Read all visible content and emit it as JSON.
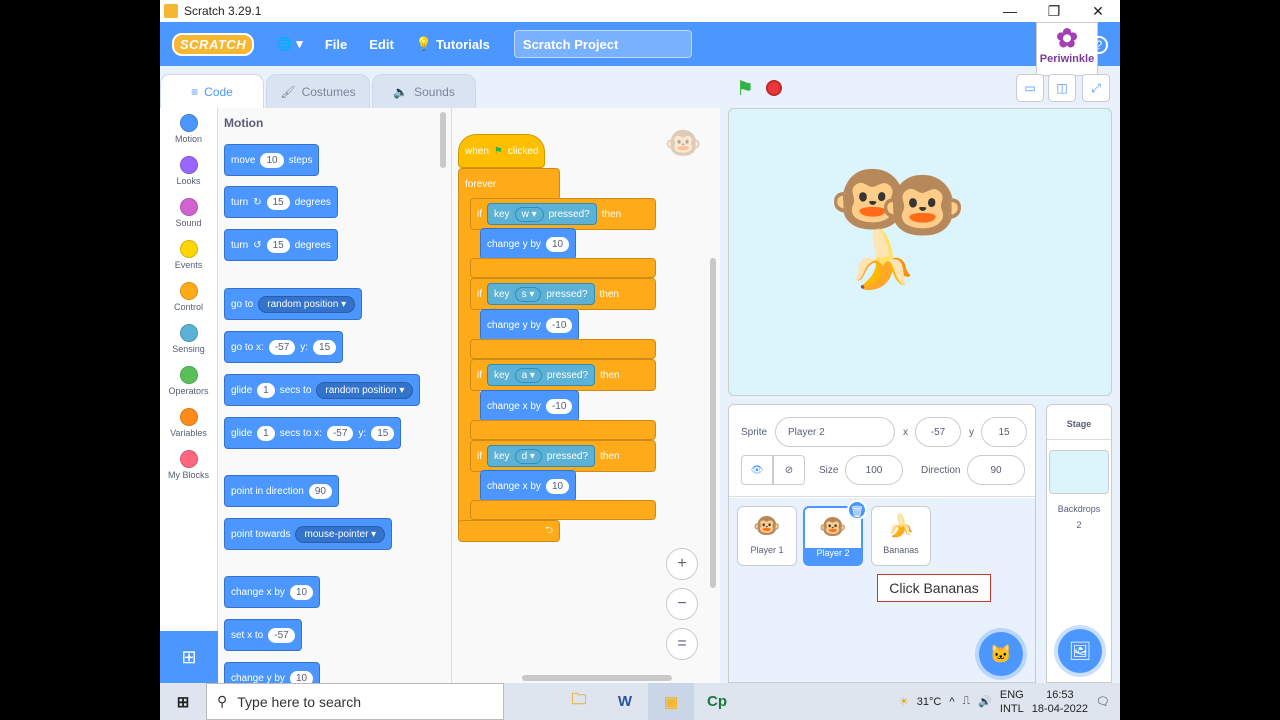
{
  "window": {
    "title": "Scratch 3.29.1",
    "controls": [
      "—",
      "❐",
      "✕"
    ]
  },
  "menu": {
    "logo": "SCRATCH",
    "file": "File",
    "edit": "Edit",
    "tutorials": "Tutorials",
    "project_title": "Scratch Project"
  },
  "overlay": {
    "brand": "Periwinkle"
  },
  "tabs": {
    "code": "Code",
    "costumes": "Costumes",
    "sounds": "Sounds"
  },
  "categories": [
    {
      "label": "Motion",
      "color": "#4c97ff"
    },
    {
      "label": "Looks",
      "color": "#9966ff"
    },
    {
      "label": "Sound",
      "color": "#cf63cf"
    },
    {
      "label": "Events",
      "color": "#ffd500"
    },
    {
      "label": "Control",
      "color": "#ffab19"
    },
    {
      "label": "Sensing",
      "color": "#5cb1d6"
    },
    {
      "label": "Operators",
      "color": "#59c059"
    },
    {
      "label": "Variables",
      "color": "#ff8c1a"
    },
    {
      "label": "My Blocks",
      "color": "#ff6680"
    }
  ],
  "palette": {
    "heading": "Motion",
    "move": {
      "a": "move",
      "v": "10",
      "b": "steps"
    },
    "turn_right": {
      "a": "turn",
      "v": "15",
      "b": "degrees"
    },
    "turn_left": {
      "a": "turn",
      "v": "15",
      "b": "degrees"
    },
    "goto": {
      "a": "go to",
      "d": "random position ▾"
    },
    "gotoxy": {
      "a": "go to x:",
      "x": "-57",
      "b": "y:",
      "y": "15"
    },
    "glide": {
      "a": "glide",
      "v": "1",
      "b": "secs to",
      "d": "random position ▾"
    },
    "glidexy": {
      "a": "glide",
      "v": "1",
      "b": "secs to x:",
      "x": "-57",
      "c": "y:",
      "y": "15"
    },
    "point": {
      "a": "point in direction",
      "v": "90"
    },
    "towards": {
      "a": "point towards",
      "d": "mouse-pointer ▾"
    },
    "changex": {
      "a": "change x by",
      "v": "10"
    },
    "setx": {
      "a": "set x to",
      "v": "-57"
    },
    "changey": {
      "a": "change y by",
      "v": "10"
    }
  },
  "script": {
    "hat": {
      "a": "when",
      "b": "clicked"
    },
    "forever": "forever",
    "ifs": [
      {
        "if": "if",
        "key": "key",
        "k": "w ▾",
        "pressed": "pressed?",
        "then": "then",
        "action": "change y by",
        "v": "10"
      },
      {
        "if": "if",
        "key": "key",
        "k": "s ▾",
        "pressed": "pressed?",
        "then": "then",
        "action": "change y by",
        "v": "-10"
      },
      {
        "if": "if",
        "key": "key",
        "k": "a ▾",
        "pressed": "pressed?",
        "then": "then",
        "action": "change x by",
        "v": "-10"
      },
      {
        "if": "if",
        "key": "key",
        "k": "d ▾",
        "pressed": "pressed?",
        "then": "then",
        "action": "change x by",
        "v": "10"
      }
    ],
    "loop_arrow": "⮌"
  },
  "zoom": {
    "in": "+",
    "out": "−",
    "reset": "="
  },
  "sprite_info": {
    "sprite_label": "Sprite",
    "sprite_name": "Player 2",
    "x_label": "x",
    "x": "-57",
    "y_label": "y",
    "y": "15",
    "size_label": "Size",
    "size": "100",
    "direction_label": "Direction",
    "direction": "90"
  },
  "sprites": [
    {
      "name": "Player 1",
      "icon": "🐵"
    },
    {
      "name": "Player 2",
      "icon": "🐵"
    },
    {
      "name": "Bananas",
      "icon": "🍌"
    }
  ],
  "tooltip": "Click Bananas",
  "stage_panel": {
    "title": "Stage",
    "backdrops_label": "Backdrops",
    "backdrops_count": "2"
  },
  "taskbar": {
    "search": "Type here to search",
    "weather": "31°C",
    "lang1": "ENG",
    "lang2": "INTL",
    "time": "16:53",
    "date": "18-04-2022"
  }
}
